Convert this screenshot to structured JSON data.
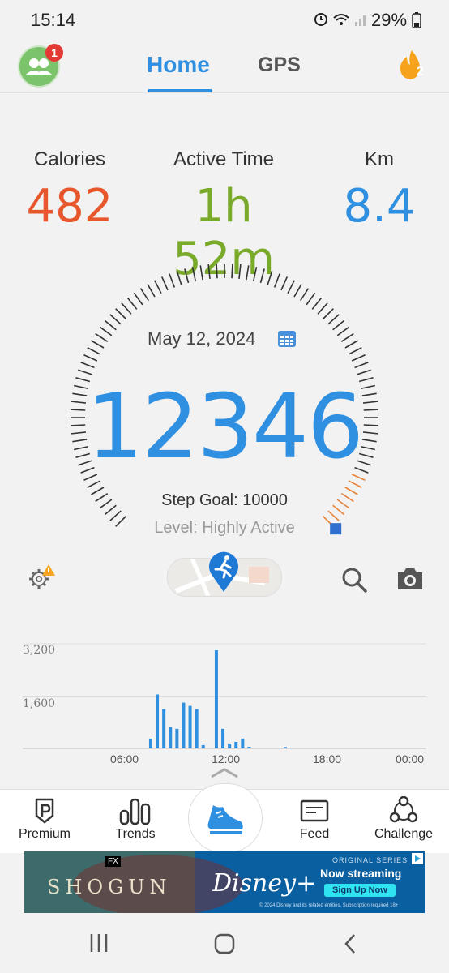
{
  "status_bar": {
    "time": "15:14",
    "battery": "29%"
  },
  "header": {
    "tabs": [
      {
        "label": "Home",
        "active": true
      },
      {
        "label": "GPS",
        "active": false
      }
    ],
    "notification_count": "1",
    "streak_count": "2"
  },
  "stats": [
    {
      "label": "Calories",
      "value": "482",
      "color": "#e8562c"
    },
    {
      "label": "Active Time",
      "value": "1h 52m",
      "color": "#7aaa2a"
    },
    {
      "label": "Km",
      "value": "8.4",
      "color": "#2f8fe0"
    }
  ],
  "gauge": {
    "date": "May 12, 2024",
    "steps": "12346",
    "step_goal": "Step Goal: 10000",
    "level": "Level: Highly Active",
    "progress": 1.0
  },
  "chart_data": {
    "type": "bar",
    "y_ticks": [
      "3,200",
      "1,600"
    ],
    "x_ticks": [
      "06:00",
      "12:00",
      "18:00",
      "00:00"
    ],
    "ylim": [
      0,
      3600
    ],
    "x": [
      7.8,
      8.2,
      8.6,
      9.0,
      9.4,
      9.8,
      10.2,
      10.6,
      11.0,
      11.8,
      12.2,
      12.6,
      13.0,
      13.4,
      13.8,
      16.0
    ],
    "values": [
      300,
      1650,
      1200,
      650,
      600,
      1400,
      1300,
      1200,
      100,
      3000,
      600,
      150,
      200,
      300,
      50,
      40
    ],
    "color": "#2f8fe0"
  },
  "bottom_nav": {
    "items": [
      {
        "label": "Premium"
      },
      {
        "label": "Trends"
      },
      {
        "label": ""
      },
      {
        "label": "Feed"
      },
      {
        "label": "Challenge"
      }
    ]
  },
  "ad": {
    "title": "SHOGUN",
    "fx": "FX",
    "series": "ORIGINAL SERIES",
    "streaming": "Now streaming",
    "brand": "Disney+",
    "cta": "Sign Up Now",
    "fine_print": "© 2024 Disney and its related entities. Subscription required 18+"
  }
}
